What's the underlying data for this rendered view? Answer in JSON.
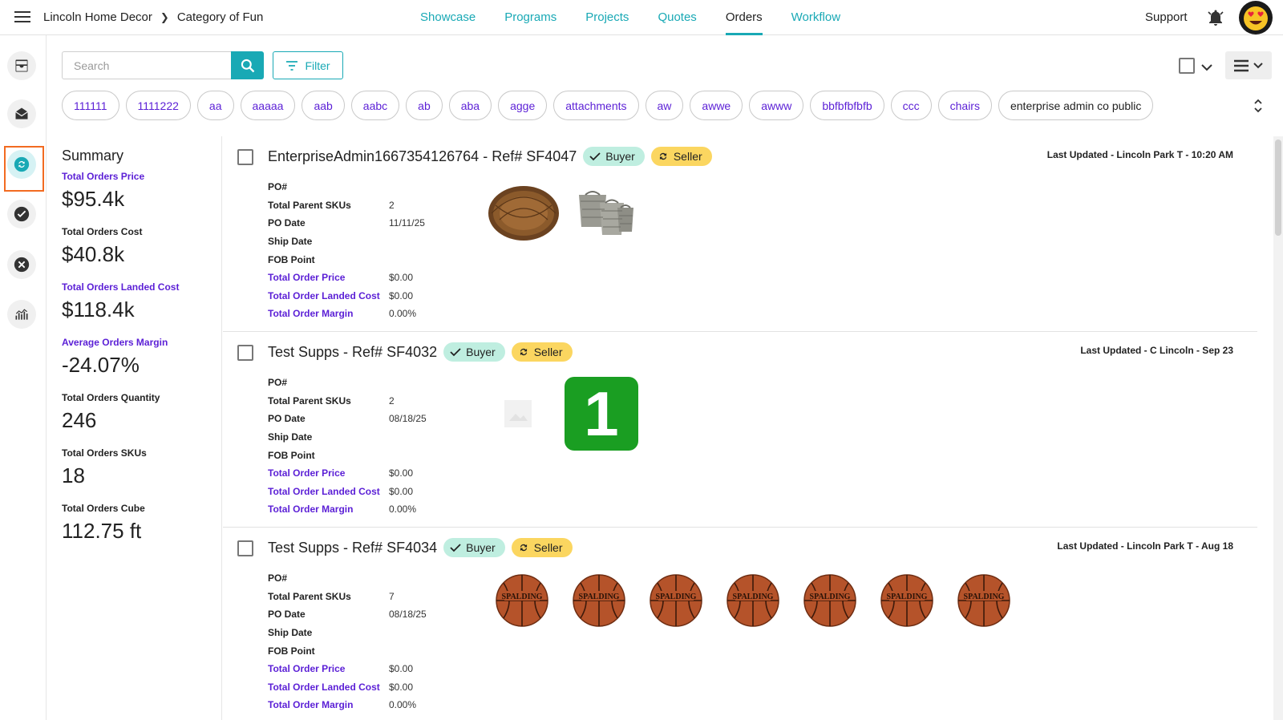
{
  "header": {
    "breadcrumb": [
      "Lincoln Home Decor",
      "Category of Fun"
    ],
    "nav": [
      "Showcase",
      "Programs",
      "Projects",
      "Quotes",
      "Orders",
      "Workflow"
    ],
    "active_nav": "Orders",
    "support_label": "Support"
  },
  "rail": {
    "icons": [
      "inbox-icon",
      "mail-icon",
      "sync-icon",
      "check-circle-icon",
      "cancel-circle-icon",
      "analytics-icon"
    ],
    "active": "sync-icon"
  },
  "toolbar": {
    "search_placeholder": "Search",
    "search_value": "",
    "filter_label": "Filter"
  },
  "tags": [
    "111111",
    "1111222",
    "aa",
    "aaaaa",
    "aab",
    "aabc",
    "ab",
    "aba",
    "agge",
    "attachments",
    "aw",
    "awwe",
    "awww",
    "bbfbfbfbfb",
    "ccc",
    "chairs",
    "enterprise admin co public"
  ],
  "summary": {
    "title": "Summary",
    "items": [
      {
        "label": "Total Orders Price",
        "value": "$95.4k",
        "link": true
      },
      {
        "label": "Total Orders Cost",
        "value": "$40.8k",
        "link": false
      },
      {
        "label": "Total Orders Landed Cost",
        "value": "$118.4k",
        "link": true
      },
      {
        "label": "Average Orders Margin",
        "value": "-24.07%",
        "link": true
      },
      {
        "label": "Total Orders Quantity",
        "value": "246",
        "link": false
      },
      {
        "label": "Total Orders SKUs",
        "value": "18",
        "link": false
      },
      {
        "label": "Total Orders Cube",
        "value": "112.75 ft",
        "link": false
      }
    ]
  },
  "badges": {
    "buyer": "Buyer",
    "seller": "Seller"
  },
  "field_labels": {
    "po": "PO#",
    "parent_skus": "Total Parent SKUs",
    "po_date": "PO Date",
    "ship_date": "Ship Date",
    "fob": "FOB Point",
    "order_price": "Total Order Price",
    "landed_cost": "Total Order Landed Cost",
    "margin": "Total Order Margin"
  },
  "orders": [
    {
      "title": "EnterpriseAdmin1667354126764 - Ref# SF4047",
      "updated": "Last Updated - Lincoln Park T - 10:20 AM",
      "po": "",
      "parent_skus": "2",
      "po_date": "11/11/25",
      "ship_date": "",
      "fob": "",
      "order_price": "$0.00",
      "landed_cost": "$0.00",
      "margin": "0.00%",
      "thumbs": [
        "wicker-charger-plate-image",
        "wicker-baskets-image"
      ]
    },
    {
      "title": "Test Supps - Ref# SF4032",
      "updated": "Last Updated - C Lincoln - Sep 23",
      "po": "",
      "parent_skus": "2",
      "po_date": "08/18/25",
      "ship_date": "",
      "fob": "",
      "order_price": "$0.00",
      "landed_cost": "$0.00",
      "margin": "0.00%",
      "thumbs": [
        "placeholder-image",
        "number-one-image"
      ],
      "number_badge": "1"
    },
    {
      "title": "Test Supps - Ref# SF4034",
      "updated": "Last Updated - Lincoln Park T - Aug 18",
      "po": "",
      "parent_skus": "7",
      "po_date": "08/18/25",
      "ship_date": "",
      "fob": "",
      "order_price": "$0.00",
      "landed_cost": "$0.00",
      "margin": "0.00%",
      "thumbs": [
        "basketball-image",
        "basketball-image",
        "basketball-image",
        "basketball-image",
        "basketball-image",
        "basketball-image",
        "basketball-image"
      ],
      "ball_text": "SPALDING"
    }
  ],
  "colors": {
    "accent": "#19a9b5",
    "link": "#5b1fd6",
    "buyer": "#bfeee0",
    "seller": "#fbd660",
    "highlight": "#f26b21"
  }
}
